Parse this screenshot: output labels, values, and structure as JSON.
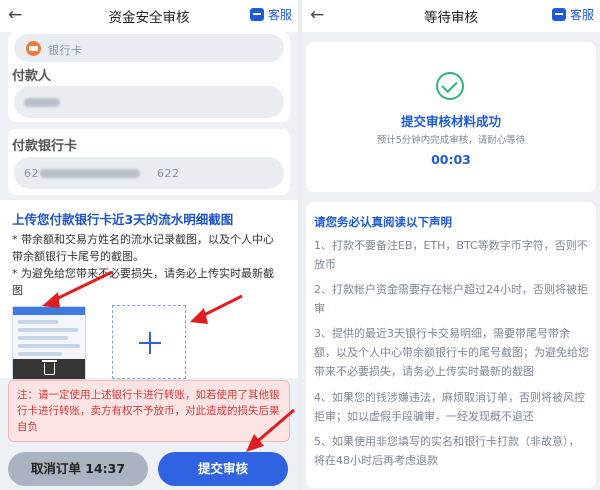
{
  "left": {
    "back_icon": "←",
    "title": "资金安全审核",
    "service_label": "客服",
    "bank_placeholder": "银行卡",
    "payer_label": "付款人",
    "payer_value": "",
    "payer_bank_card_label": "付款银行卡",
    "card_prefix": "62",
    "card_suffix": "622",
    "upload_title": "上传您付款银行卡近3天的流水明细截图",
    "upload_line1": "* 带余额和交易方姓名的流水记录截图，以及个人中心带余额银行卡尾号的截图。",
    "upload_line2": "* 为避免给您带来不必要损失，请务必上传实时最新截图",
    "warning": "注：请一定使用上述银行卡进行转账，如若使用了其他银行卡进行转账，卖方有权不予放币，对此造成的损失后果自负",
    "cancel_button": "取消订单 14:37",
    "submit_button": "提交审核"
  },
  "right": {
    "back_icon": "←",
    "title": "等待审核",
    "service_label": "客服",
    "success_title": "提交审核材料成功",
    "success_sub": "预计5分钟内完成审核，请耐心等待",
    "timer": "00:03",
    "notice_title": "请您务必认真阅读以下声明",
    "notice_items": [
      "1、打款不要备注EB，ETH，BTC等数字币字符，否则不放币",
      "2、打款帐户资金需要存在帐户超过24小时，否则将被拒审",
      "3、提供的最近3天银行卡交易明细，需要带尾号带余额，以及个人中心带余额银行卡的尾号截图；为避免给您带来不必要损失，请务必上传实时最新的截图",
      "4、如果您的钱涉嫌违法，麻烦取消订单，否则将被风控拒审；如以虚假手段骗审，一经发现概不退还",
      "5、如果使用非您填写的实名和银行卡打款（非故意），将在48小时后再考虑退款"
    ]
  },
  "colors": {
    "accent": "#1f5bd8",
    "warning": "#d63a3a",
    "success": "#2fb27b",
    "arrow": "#e11d1d"
  },
  "icons": [
    "back-arrow-icon",
    "customer-service-icon",
    "bank-card-icon",
    "add-image-icon",
    "trash-icon",
    "check-circle-icon"
  ]
}
